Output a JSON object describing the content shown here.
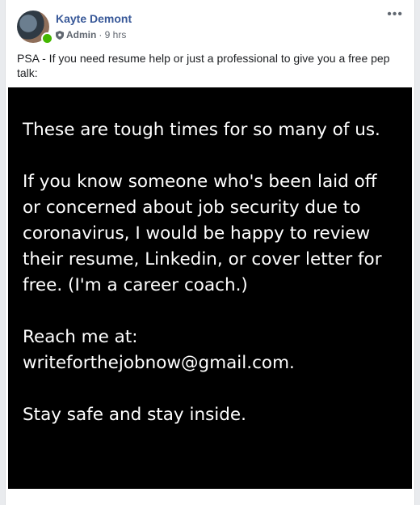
{
  "post": {
    "author": "Kayte Demont",
    "role": "Admin",
    "time": "· 9 hrs",
    "caption": "PSA - If you need resume help or just a professional to give you a free pep talk:",
    "more_icon": "•••"
  },
  "image_text": {
    "line1": "These are tough times for so many of us.",
    "para2": "If you know someone who's been laid off or concerned about job security due to coronavirus, I would be happy to review their resume, Linkedin, or cover letter for free. (I'm a career coach.)",
    "para3": "Reach me at: writeforthejobnow@gmail.com.",
    "para4": "Stay safe and stay inside."
  },
  "colors": {
    "author": "#385898",
    "online": "#44b700",
    "image_bg": "#000000"
  }
}
